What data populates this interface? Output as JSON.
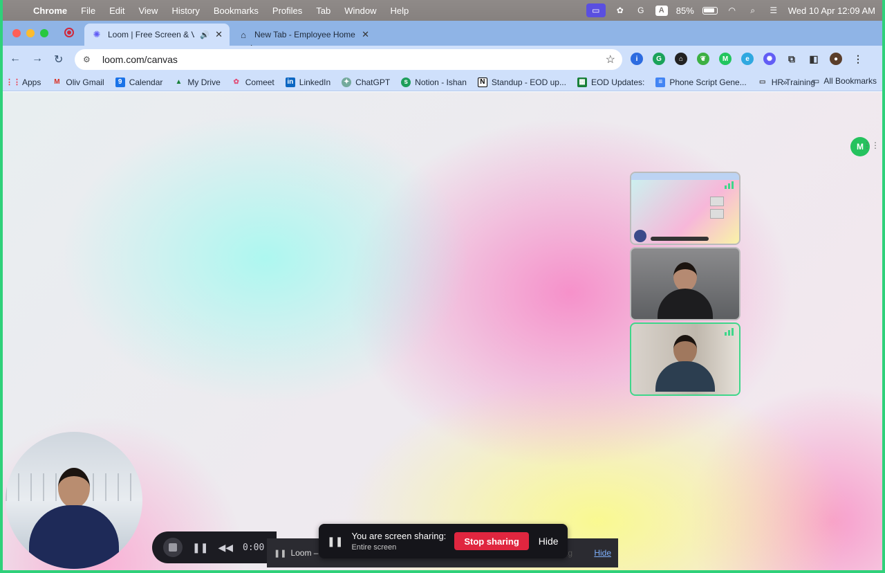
{
  "menubar": {
    "app": "Chrome",
    "items": [
      "File",
      "Edit",
      "View",
      "History",
      "Bookmarks",
      "Profiles",
      "Tab",
      "Window",
      "Help"
    ],
    "battery": "85%",
    "datetime": "Wed 10 Apr  12:09 AM",
    "input_badge": "A"
  },
  "tabs": [
    {
      "title": "Loom | Free Screen & Video",
      "favicon": "loom-icon",
      "active": true
    },
    {
      "title": "New Tab - Employee Home",
      "favicon": "home-icon",
      "active": false
    }
  ],
  "toolbar": {
    "url": "loom.com/canvas"
  },
  "bookmarks": {
    "items": [
      {
        "label": "Apps",
        "icon": "grid-icon"
      },
      {
        "label": "Oliv Gmail",
        "icon": "gmail-icon"
      },
      {
        "label": "Calendar",
        "icon": "calendar-icon"
      },
      {
        "label": "My Drive",
        "icon": "drive-icon"
      },
      {
        "label": "Comeet",
        "icon": "comeet-icon"
      },
      {
        "label": "LinkedIn",
        "icon": "linkedin-icon"
      },
      {
        "label": "ChatGPT",
        "icon": "chatgpt-icon"
      },
      {
        "label": "Notion - Ishan",
        "icon": "notion-icon"
      },
      {
        "label": "Standup - EOD up...",
        "icon": "notion-icon"
      },
      {
        "label": "EOD Updates:",
        "icon": "sheets-icon"
      },
      {
        "label": "Phone Script Gene...",
        "icon": "docs-icon"
      },
      {
        "label": "HR Training",
        "icon": "folder-icon"
      }
    ],
    "more": "»",
    "all": "All Bookmarks"
  },
  "loom": {
    "timer": "0:00",
    "window_label": "Loom – Sc",
    "ghost_label": "ing",
    "hide_link": "Hide"
  },
  "share_banner": {
    "line1": "You are screen sharing:",
    "line2": "Entire screen",
    "stop": "Stop sharing",
    "hide": "Hide"
  },
  "extension_badge": "M",
  "colors": {
    "accent_green": "#2fd17a",
    "stop_red": "#e0263f",
    "chrome_blue": "#cfe0fb"
  }
}
